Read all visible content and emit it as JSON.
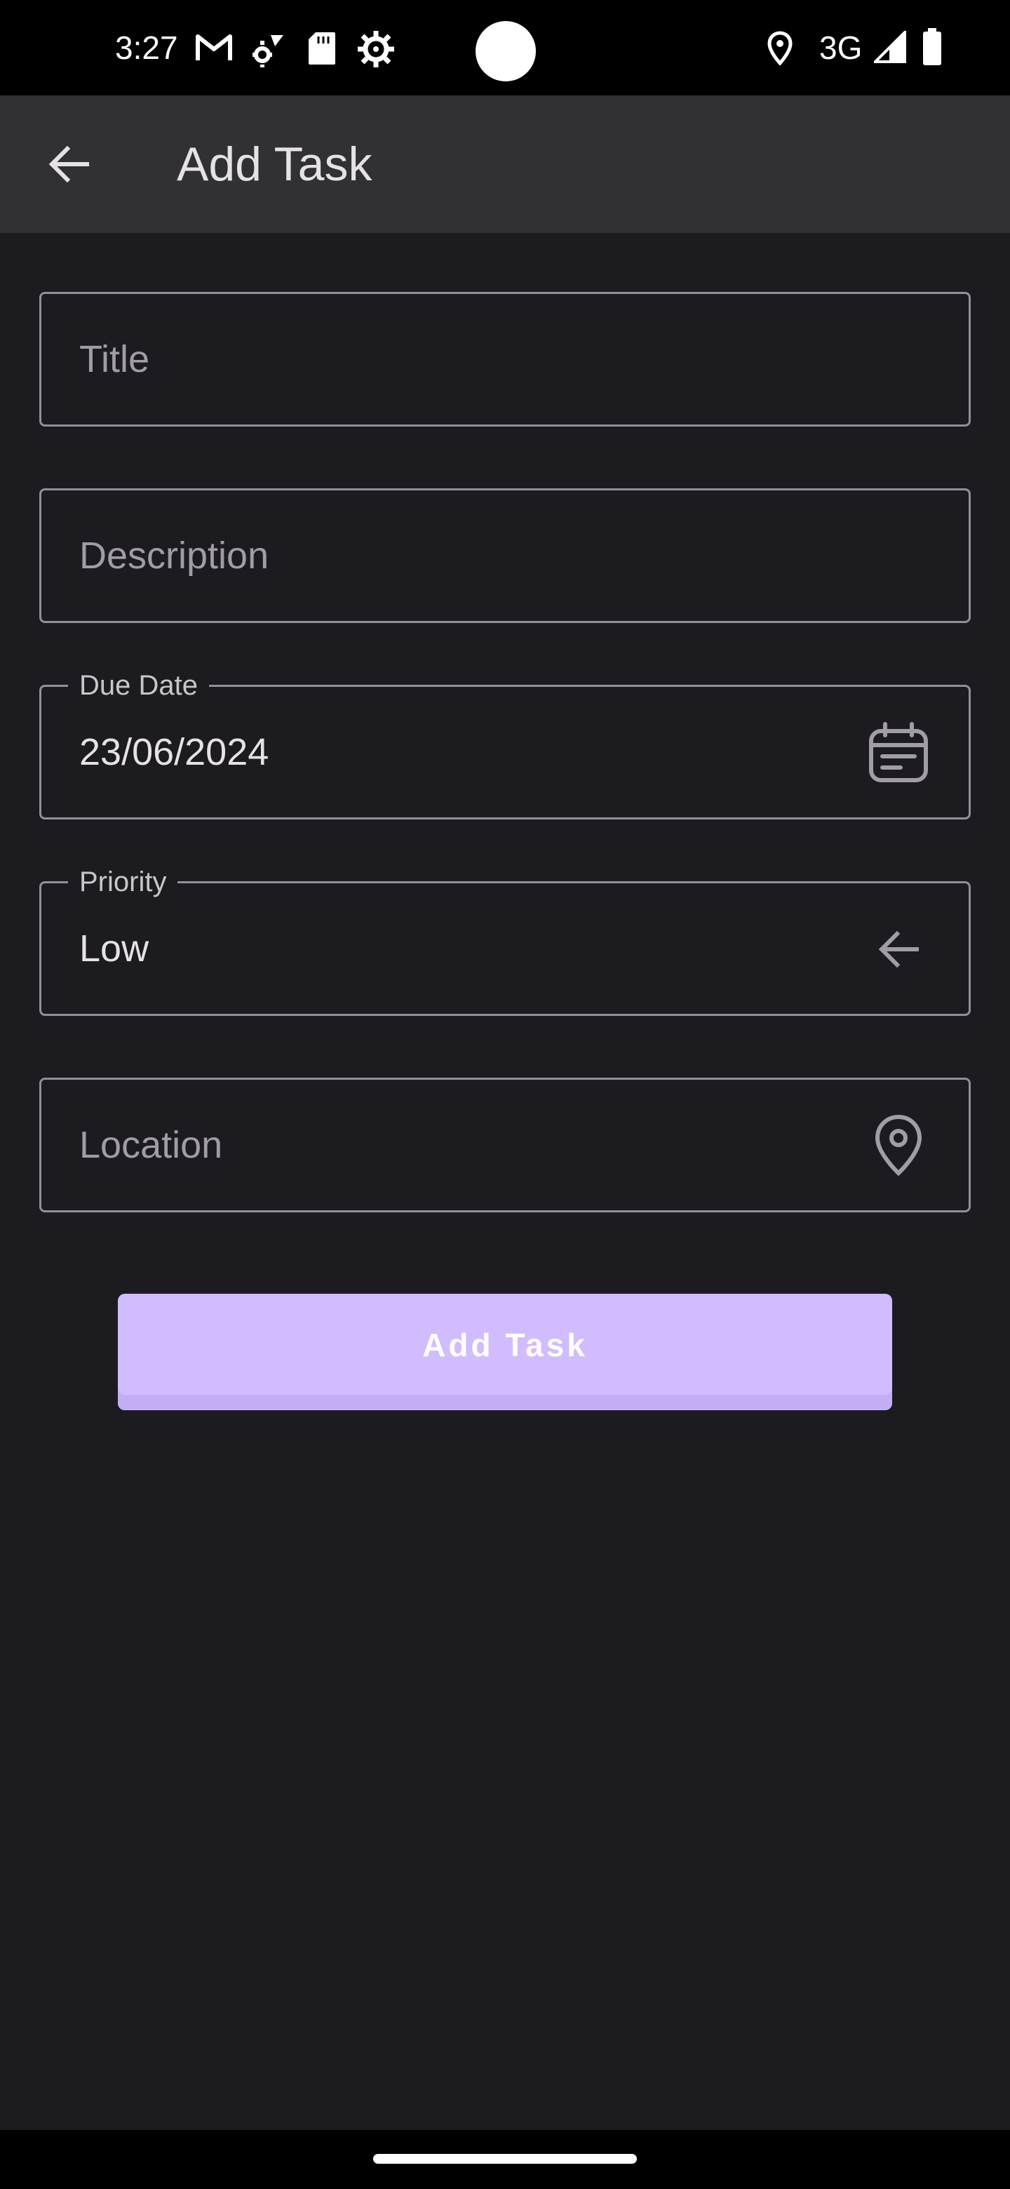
{
  "status_bar": {
    "time": "3:27",
    "network": "3G",
    "icons": [
      "gmail-icon",
      "settings-sync-icon",
      "sd-card-icon",
      "gear-icon",
      "location-icon",
      "signal-icon",
      "battery-icon"
    ]
  },
  "app_bar": {
    "title": "Add Task",
    "back_icon": "arrow-back-icon"
  },
  "form": {
    "title": {
      "placeholder": "Title",
      "value": ""
    },
    "description": {
      "placeholder": "Description",
      "value": ""
    },
    "due_date": {
      "label": "Due Date",
      "value": "23/06/2024",
      "icon": "calendar-icon"
    },
    "priority": {
      "label": "Priority",
      "value": "Low",
      "icon": "arrow-back-icon"
    },
    "location": {
      "placeholder": "Location",
      "value": "",
      "icon": "location-pin-icon"
    }
  },
  "add_button": {
    "label": "Add Task"
  },
  "colors": {
    "background": "#1c1b1f",
    "app_bar": "#313034",
    "accent": "#d0bcff",
    "outline": "#938f99"
  }
}
